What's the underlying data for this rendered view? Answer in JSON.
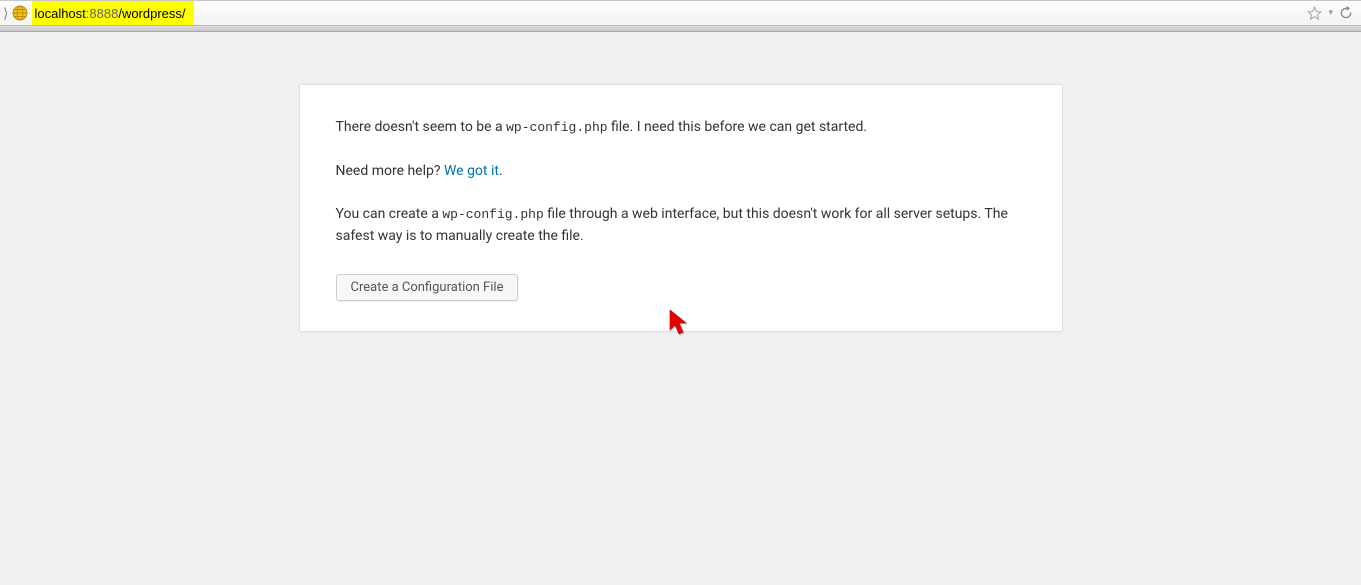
{
  "browser": {
    "url_host": "localhost",
    "url_port": ":8888",
    "url_path": "/wordpress/"
  },
  "message": {
    "p1_pre": "There doesn't seem to be a ",
    "p1_code": "wp-config.php",
    "p1_post": " file. I need this before we can get started.",
    "p2_pre": "Need more help? ",
    "p2_link": "We got it",
    "p2_post": ".",
    "p3_pre": "You can create a ",
    "p3_code": "wp-config.php",
    "p3_post": " file through a web interface, but this doesn't work for all server setups. The safest way is to manually create the file."
  },
  "button": {
    "create_label": "Create a Configuration File"
  }
}
